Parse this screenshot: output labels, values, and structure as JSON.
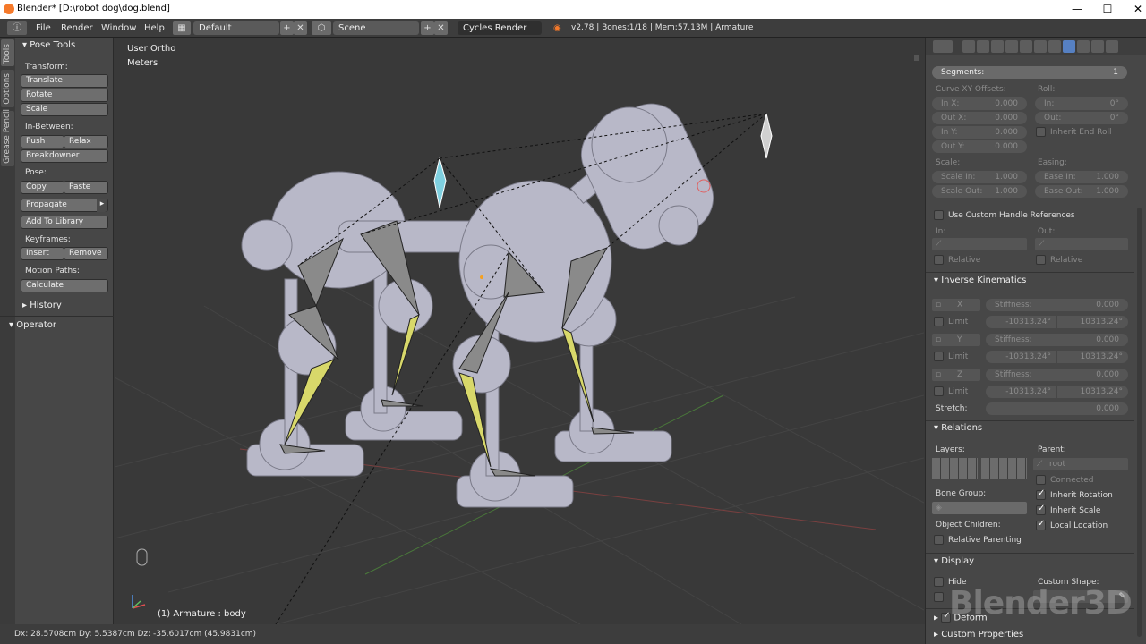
{
  "window": {
    "title": "Blender* [D:\\robot dog\\dog.blend]"
  },
  "menubar": {
    "menus": [
      "File",
      "Render",
      "Window",
      "Help"
    ],
    "layout": "Default",
    "scene": "Scene",
    "engine": "Cycles Render",
    "info": "v2.78 | Bones:1/18 | Mem:57.13M | Armature"
  },
  "toolshelf": {
    "tabs": [
      "Tools",
      "Options",
      "Grease Pencil"
    ],
    "panel_title": "Pose Tools",
    "transform_label": "Transform:",
    "translate": "Translate",
    "rotate": "Rotate",
    "scale": "Scale",
    "inbetween_label": "In-Between:",
    "push": "Push",
    "relax": "Relax",
    "breakdowner": "Breakdowner",
    "pose_label": "Pose:",
    "copy": "Copy",
    "paste": "Paste",
    "propagate": "Propagate",
    "add_to_library": "Add To Library",
    "keyframes_label": "Keyframes:",
    "insert": "Insert",
    "remove": "Remove",
    "motion_paths_label": "Motion Paths:",
    "calculate": "Calculate",
    "history": "History",
    "operator": "Operator"
  },
  "viewport": {
    "view_name": "User Ortho",
    "units": "Meters",
    "object_label": "(1) Armature : body"
  },
  "properties": {
    "segments_label": "Segments:",
    "segments_value": "1",
    "curve_offsets_label": "Curve XY Offsets:",
    "in_x": {
      "label": "In X:",
      "value": "0.000"
    },
    "out_x": {
      "label": "Out X:",
      "value": "0.000"
    },
    "in_y": {
      "label": "In Y:",
      "value": "0.000"
    },
    "out_y": {
      "label": "Out Y:",
      "value": "0.000"
    },
    "roll_label": "Roll:",
    "roll_in": {
      "label": "In:",
      "value": "0°"
    },
    "roll_out": {
      "label": "Out:",
      "value": "0°"
    },
    "inherit_end_roll": "Inherit End Roll",
    "scale_label": "Scale:",
    "scale_in": {
      "label": "Scale In:",
      "value": "1.000"
    },
    "scale_out": {
      "label": "Scale Out:",
      "value": "1.000"
    },
    "easing_label": "Easing:",
    "ease_in": {
      "label": "Ease In:",
      "value": "1.000"
    },
    "ease_out": {
      "label": "Ease Out:",
      "value": "1.000"
    },
    "use_custom_handle": "Use Custom Handle References",
    "in_label": "In:",
    "out_label": "Out:",
    "relative": "Relative",
    "ik_title": "Inverse Kinematics",
    "ik_rows": [
      {
        "axis": "X",
        "stiffness_label": "Stiffness:",
        "stiffness": "0.000",
        "limit": "Limit",
        "min": "-10313.24°",
        "max": "10313.24°"
      },
      {
        "axis": "Y",
        "stiffness_label": "Stiffness:",
        "stiffness": "0.000",
        "limit": "Limit",
        "min": "-10313.24°",
        "max": "10313.24°"
      },
      {
        "axis": "Z",
        "stiffness_label": "Stiffness:",
        "stiffness": "0.000",
        "limit": "Limit",
        "min": "-10313.24°",
        "max": "10313.24°"
      }
    ],
    "stretch_label": "Stretch:",
    "stretch_value": "0.000",
    "relations_title": "Relations",
    "layers_label": "Layers:",
    "parent_label": "Parent:",
    "parent_value": "root",
    "connected": "Connected",
    "bone_group_label": "Bone Group:",
    "inherit_rotation": "Inherit Rotation",
    "object_children_label": "Object Children:",
    "inherit_scale": "Inherit Scale",
    "local_location": "Local Location",
    "relative_parenting": "Relative Parenting",
    "display_title": "Display",
    "hide": "Hide",
    "custom_shape_label": "Custom Shape:",
    "deform_title": "Deform",
    "custom_props_title": "Custom Properties"
  },
  "statusbar": {
    "text": "Dx: 28.5708cm  Dy: 5.5387cm  Dz: -35.6017cm (45.9831cm)"
  },
  "watermark": "Blender3D",
  "colors": {
    "accent": "#5680c2",
    "bone_selected": "#d8d86a",
    "bone": "#8a8a8a"
  }
}
